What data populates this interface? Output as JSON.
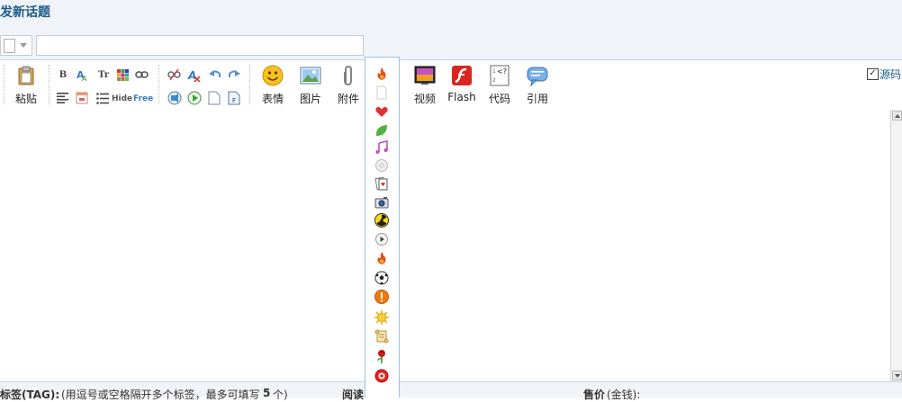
{
  "page_title": "发新话题",
  "toolbar": {
    "paste": "粘贴",
    "bold": "B",
    "font_size": "Tr",
    "hide": "Hide",
    "free": "Free",
    "emoticons": "表情",
    "image": "图片",
    "attachment": "附件",
    "video": "视频",
    "flash": "Flash",
    "code": "代码",
    "quote": "引用",
    "source_mode": "源码",
    "source_checked": "✓"
  },
  "bottom": {
    "tags_label": "标签(TAG):",
    "tags_hint": "(用逗号或空格隔开多个标签，最多可填写",
    "tags_count": "5",
    "tags_unit": "个)",
    "read_label": "阅读",
    "price_label": "售价",
    "price_hint": "(金钱):"
  },
  "dropdown_icons": [
    "fire-icon",
    "blank-icon",
    "heart-icon",
    "leaf-icon",
    "music-icon",
    "disc-icon",
    "cards-icon",
    "camera-icon",
    "radiation-icon",
    "play-icon",
    "fire-icon",
    "soccer-icon",
    "warning-icon",
    "sun-icon",
    "scroll-icon",
    "rose-icon",
    "lifebuoy-icon"
  ]
}
